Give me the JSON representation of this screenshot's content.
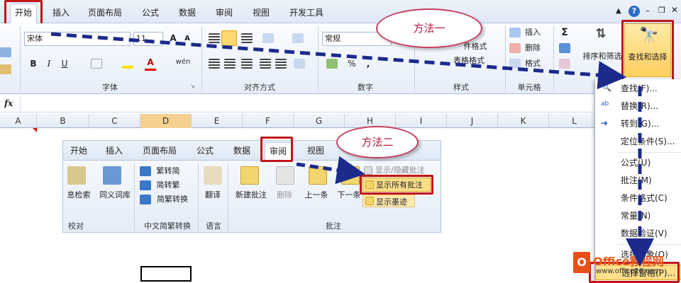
{
  "tabs": [
    "开始",
    "插入",
    "页面布局",
    "公式",
    "数据",
    "审阅",
    "视图",
    "开发工具"
  ],
  "font": {
    "name": "宋体",
    "size": "11",
    "group_label": "字体"
  },
  "alignment": {
    "group_label": "对齐方式"
  },
  "number": {
    "format": "常规",
    "group_label": "数字",
    "percent": "%",
    "comma": ","
  },
  "styles": {
    "group_label": "样式",
    "conditional": "件格式",
    "table": "表格格式"
  },
  "cells": {
    "insert": "插入",
    "delete": "删除",
    "format": "格式",
    "group_label": "单元格"
  },
  "editing": {
    "sort_filter": "排序和筛选",
    "find_select": "查找和选择"
  },
  "formula_bar": {
    "fx": "fx"
  },
  "columns": [
    "A",
    "B",
    "C",
    "D",
    "E",
    "F",
    "G",
    "H",
    "I",
    "J",
    "K",
    "L"
  ],
  "callout1": "方法一",
  "callout2": "方法二",
  "inset": {
    "tabs": [
      "开始",
      "插入",
      "页面布局",
      "公式",
      "数据",
      "审阅",
      "视图"
    ],
    "research": "息检索",
    "thesaurus": "同义词库",
    "to_trad": "繁转简",
    "to_simp": "简转繁",
    "convert": "简繁转换",
    "translate": "翻译",
    "new_comment": "新建批注",
    "delete": "删除",
    "prev": "上一条",
    "next": "下一条",
    "show_hide": "显示/隐藏批注",
    "show_all": "显示所有批注",
    "show_ink": "显示墨迹",
    "grp_proof": "校对",
    "grp_cn": "中文简繁转换",
    "grp_lang": "语言",
    "grp_comments": "批注"
  },
  "dropdown": {
    "items": [
      "查找(F)...",
      "替换(R)...",
      "转到(G)...",
      "定位条件(S)...",
      "公式(U)",
      "批注(M)",
      "条件格式(C)",
      "常量(N)",
      "数据验证(V)",
      "选择对象(O)",
      "选择窗格(P)..."
    ]
  },
  "watermark": {
    "brand": "Office教程网",
    "url": "www.office26.com"
  }
}
